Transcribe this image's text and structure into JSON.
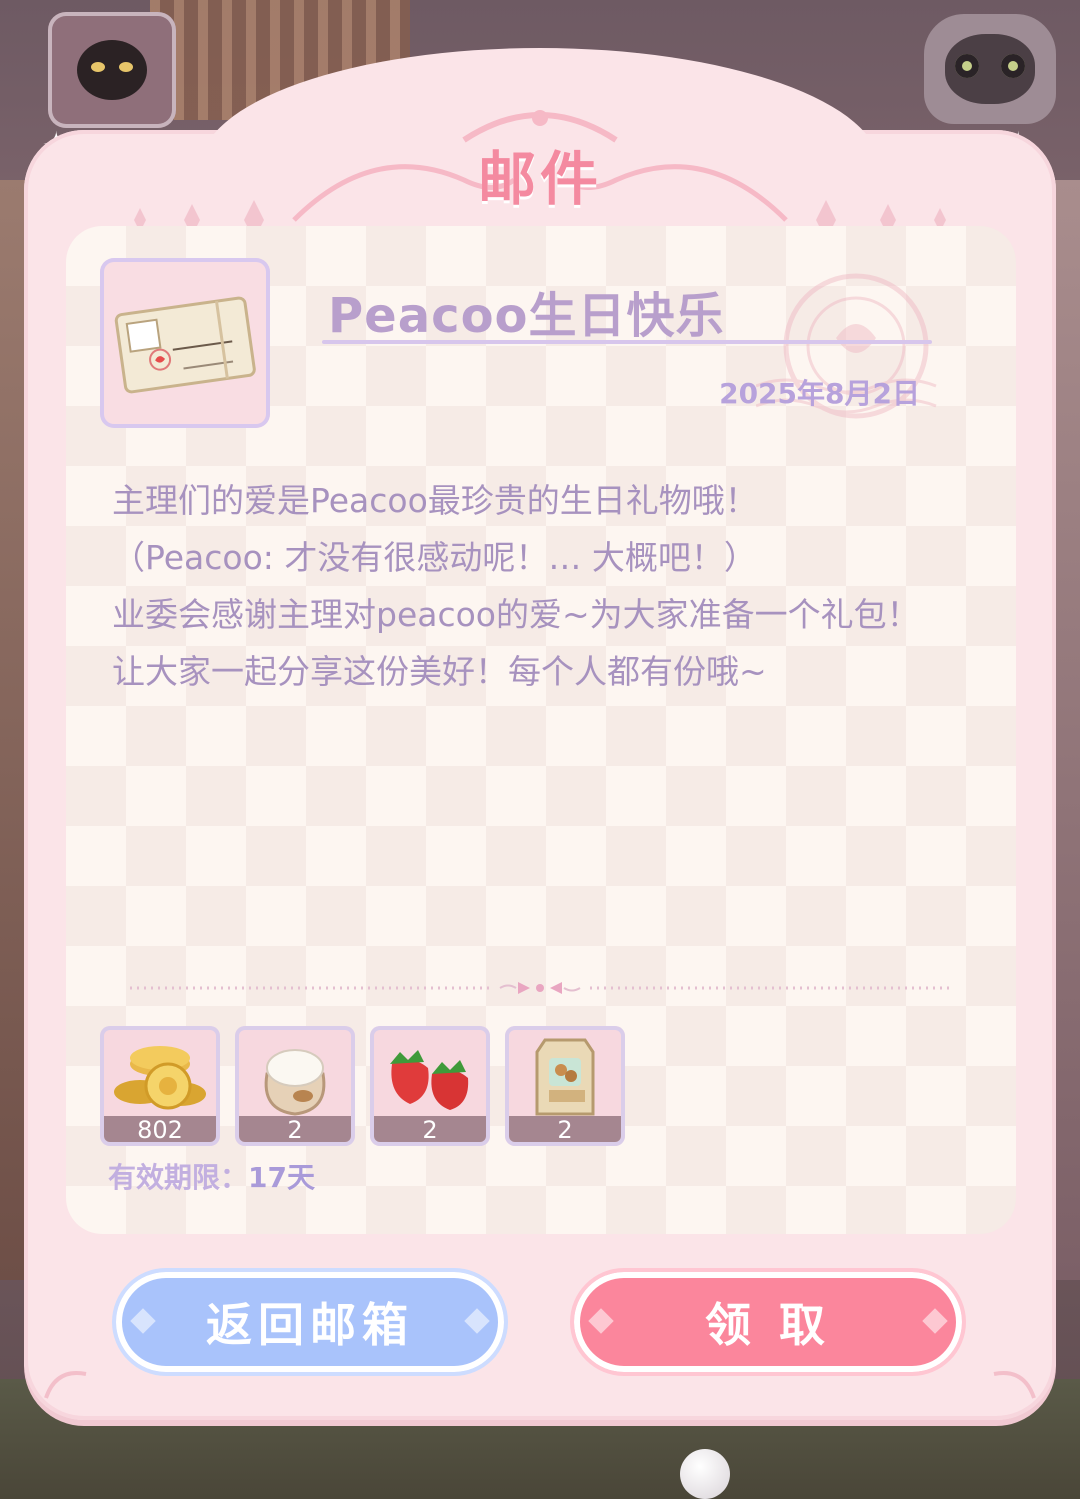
{
  "dialog": {
    "title": "邮件"
  },
  "mail": {
    "title": "Peacoo生日快乐",
    "date": "2025年8月2日",
    "body": [
      "主理们的爱是Peacoo最珍贵的生日礼物哦！",
      "（Peacoo: 才没有很感动呢！… 大概吧！）",
      "业委会感谢主理对peacoo的爱~为大家准备一个礼包！",
      "让大家一起分享这份美好！每个人都有份哦~"
    ],
    "attachment_icon": "letter-icon"
  },
  "rewards": [
    {
      "icon": "gold-coins-icon",
      "quantity": "802"
    },
    {
      "icon": "flour-sack-icon",
      "quantity": "2"
    },
    {
      "icon": "strawberry-icon",
      "quantity": "2"
    },
    {
      "icon": "nuts-bag-icon",
      "quantity": "2"
    }
  ],
  "expiry": {
    "label": "有效期限：",
    "value": "17天"
  },
  "buttons": {
    "back": "返回邮箱",
    "claim": "领 取"
  },
  "colors": {
    "title_pink": "#f48aa0",
    "text_purple": "#a792bf",
    "back_button_blue": "#a9c3fb",
    "claim_button_pink": "#fb869c",
    "panel_pink": "#fbe4e8"
  }
}
